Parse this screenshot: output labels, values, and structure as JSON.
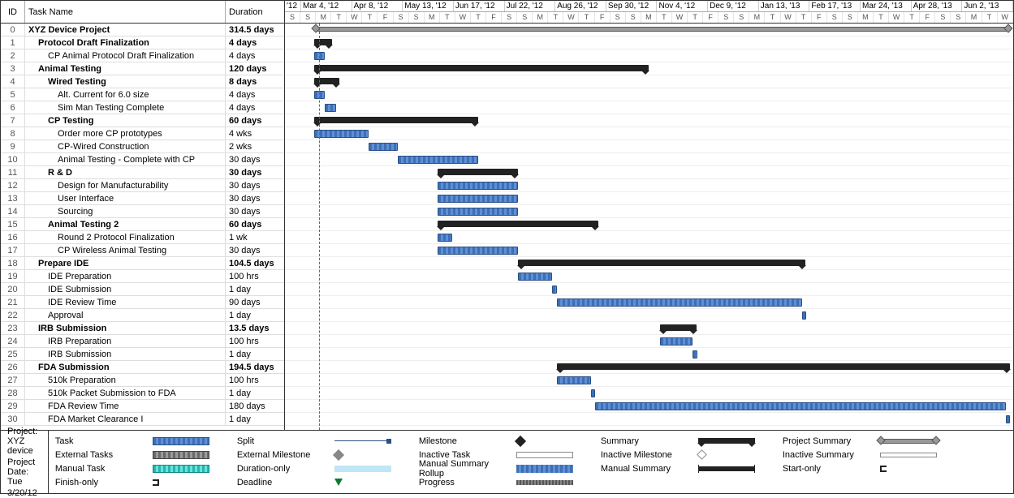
{
  "chart_data": {
    "type": "gantt",
    "project_start": "2012-03-01",
    "project_end": "2013-06-05",
    "status_date": "2012-03-20",
    "timeline_months": [
      "'12",
      "Mar 4, '12",
      "Apr 8, '12",
      "May 13, '12",
      "Jun 17, '12",
      "Jul 22, '12",
      "Aug 26, '12",
      "Sep 30, '12",
      "Nov 4, '12",
      "Dec 9, '12",
      "Jan 13, '13",
      "Feb 17, '13",
      "Mar 24, '13",
      "Apr 28, '13",
      "Jun 2, '13"
    ],
    "timeline_days": [
      "S",
      "S",
      "M",
      "T",
      "W",
      "T",
      "F",
      "S",
      "S",
      "M",
      "T",
      "W",
      "T",
      "F",
      "S",
      "S",
      "M",
      "T",
      "W",
      "T",
      "F",
      "S",
      "S",
      "M",
      "T",
      "W",
      "T",
      "F",
      "S",
      "S",
      "M",
      "T",
      "W",
      "T",
      "F",
      "S",
      "S",
      "M",
      "T",
      "W",
      "T",
      "F",
      "S",
      "S",
      "M",
      "T",
      "W"
    ],
    "tasks": [
      {
        "id": 0,
        "name": "XYZ Device Project",
        "duration": "314.5 days",
        "indent": 0,
        "bold": true,
        "type": "project",
        "bar_start": 0.04,
        "bar_end": 0.995
      },
      {
        "id": 1,
        "name": "Protocol Draft Finalization",
        "duration": "4 days",
        "indent": 1,
        "bold": true,
        "type": "summary",
        "bar_start": 0.04,
        "bar_end": 0.065
      },
      {
        "id": 2,
        "name": "CP Animal Protocol Draft Finalization",
        "duration": "4 days",
        "indent": 2,
        "bold": false,
        "type": "task",
        "bar_start": 0.04,
        "bar_end": 0.055
      },
      {
        "id": 3,
        "name": "Animal Testing",
        "duration": "120 days",
        "indent": 1,
        "bold": true,
        "type": "summary",
        "bar_start": 0.04,
        "bar_end": 0.5
      },
      {
        "id": 4,
        "name": "Wired Testing",
        "duration": "8 days",
        "indent": 2,
        "bold": true,
        "type": "summary",
        "bar_start": 0.04,
        "bar_end": 0.075
      },
      {
        "id": 5,
        "name": "Alt. Current for 6.0 size",
        "duration": "4 days",
        "indent": 3,
        "bold": false,
        "type": "task",
        "bar_start": 0.04,
        "bar_end": 0.055
      },
      {
        "id": 6,
        "name": "Sim Man Testing Complete",
        "duration": "4 days",
        "indent": 3,
        "bold": false,
        "type": "task",
        "bar_start": 0.055,
        "bar_end": 0.07
      },
      {
        "id": 7,
        "name": "CP Testing",
        "duration": "60 days",
        "indent": 2,
        "bold": true,
        "type": "summary",
        "bar_start": 0.04,
        "bar_end": 0.265
      },
      {
        "id": 8,
        "name": "Order more CP prototypes",
        "duration": "4 wks",
        "indent": 3,
        "bold": false,
        "type": "task",
        "bar_start": 0.04,
        "bar_end": 0.115
      },
      {
        "id": 9,
        "name": "CP-Wired  Construction",
        "duration": "2 wks",
        "indent": 3,
        "bold": false,
        "type": "task",
        "bar_start": 0.115,
        "bar_end": 0.155
      },
      {
        "id": 10,
        "name": "Animal Testing -  Complete with CP",
        "duration": "30 days",
        "indent": 3,
        "bold": false,
        "type": "task",
        "bar_start": 0.155,
        "bar_end": 0.265
      },
      {
        "id": 11,
        "name": "R & D",
        "duration": "30 days",
        "indent": 2,
        "bold": true,
        "type": "summary",
        "bar_start": 0.21,
        "bar_end": 0.32
      },
      {
        "id": 12,
        "name": "Design for Manufacturability",
        "duration": "30 days",
        "indent": 3,
        "bold": false,
        "type": "task",
        "bar_start": 0.21,
        "bar_end": 0.32
      },
      {
        "id": 13,
        "name": "User Interface",
        "duration": "30 days",
        "indent": 3,
        "bold": false,
        "type": "task",
        "bar_start": 0.21,
        "bar_end": 0.32
      },
      {
        "id": 14,
        "name": "Sourcing",
        "duration": "30 days",
        "indent": 3,
        "bold": false,
        "type": "task",
        "bar_start": 0.21,
        "bar_end": 0.32
      },
      {
        "id": 15,
        "name": "Animal Testing 2",
        "duration": "60 days",
        "indent": 2,
        "bold": true,
        "type": "summary",
        "bar_start": 0.21,
        "bar_end": 0.43
      },
      {
        "id": 16,
        "name": "Round 2 Protocol  Finalization",
        "duration": "1 wk",
        "indent": 3,
        "bold": false,
        "type": "task",
        "bar_start": 0.21,
        "bar_end": 0.23
      },
      {
        "id": 17,
        "name": "CP Wireless Animal Testing",
        "duration": "30 days",
        "indent": 3,
        "bold": false,
        "type": "task",
        "bar_start": 0.21,
        "bar_end": 0.32
      },
      {
        "id": 18,
        "name": "Prepare IDE",
        "duration": "104.5 days",
        "indent": 1,
        "bold": true,
        "type": "summary",
        "bar_start": 0.32,
        "bar_end": 0.715
      },
      {
        "id": 19,
        "name": "IDE Preparation",
        "duration": "100 hrs",
        "indent": 2,
        "bold": false,
        "type": "task",
        "bar_start": 0.32,
        "bar_end": 0.367
      },
      {
        "id": 20,
        "name": "IDE Submission",
        "duration": "1 day",
        "indent": 2,
        "bold": false,
        "type": "task",
        "bar_start": 0.367,
        "bar_end": 0.373
      },
      {
        "id": 21,
        "name": "IDE Review Time",
        "duration": "90 days",
        "indent": 2,
        "bold": false,
        "type": "task",
        "bar_start": 0.373,
        "bar_end": 0.71
      },
      {
        "id": 22,
        "name": "Approval",
        "duration": "1 day",
        "indent": 2,
        "bold": false,
        "type": "task",
        "bar_start": 0.71,
        "bar_end": 0.716
      },
      {
        "id": 23,
        "name": "IRB Submission",
        "duration": "13.5 days",
        "indent": 1,
        "bold": true,
        "type": "summary",
        "bar_start": 0.515,
        "bar_end": 0.565
      },
      {
        "id": 24,
        "name": "IRB Preparation",
        "duration": "100 hrs",
        "indent": 2,
        "bold": false,
        "type": "task",
        "bar_start": 0.515,
        "bar_end": 0.56
      },
      {
        "id": 25,
        "name": "IRB Submission",
        "duration": "1 day",
        "indent": 2,
        "bold": false,
        "type": "task",
        "bar_start": 0.56,
        "bar_end": 0.566
      },
      {
        "id": 26,
        "name": "FDA Submission",
        "duration": "194.5 days",
        "indent": 1,
        "bold": true,
        "type": "summary",
        "bar_start": 0.373,
        "bar_end": 0.995
      },
      {
        "id": 27,
        "name": "510k Preparation",
        "duration": "100 hrs",
        "indent": 2,
        "bold": false,
        "type": "task",
        "bar_start": 0.373,
        "bar_end": 0.42
      },
      {
        "id": 28,
        "name": "510k Packet Submission to FDA",
        "duration": "1 day",
        "indent": 2,
        "bold": false,
        "type": "task",
        "bar_start": 0.42,
        "bar_end": 0.426
      },
      {
        "id": 29,
        "name": "FDA Review Time",
        "duration": "180 days",
        "indent": 2,
        "bold": false,
        "type": "task",
        "bar_start": 0.426,
        "bar_end": 0.99
      },
      {
        "id": 30,
        "name": "FDA Market Clearance I",
        "duration": "1 day",
        "indent": 2,
        "bold": false,
        "type": "task",
        "bar_start": 0.99,
        "bar_end": 0.996
      }
    ]
  },
  "columns": {
    "id": "ID",
    "name": "Task Name",
    "dur": "Duration"
  },
  "footer": {
    "proj_label": "Project: XYZ device",
    "date_label1": "Project Date: Tue",
    "date_label2": "3/20/12"
  },
  "legend": [
    {
      "label": "Task",
      "sw": "sw-task"
    },
    {
      "label": "Split",
      "sw": "sw-split"
    },
    {
      "label": "Milestone",
      "sw": "sw-mile"
    },
    {
      "label": "Summary",
      "sw": "sw-sum"
    },
    {
      "label": "Project Summary",
      "sw": "sw-projSum"
    },
    {
      "label": "External Tasks",
      "sw": "sw-ext"
    },
    {
      "label": "External Milestone",
      "sw": "sw-extMile"
    },
    {
      "label": "Inactive Task",
      "sw": "sw-inactTask"
    },
    {
      "label": "Inactive Milestone",
      "sw": "sw-inactMile"
    },
    {
      "label": "Inactive Summary",
      "sw": "sw-inactSum"
    },
    {
      "label": "Manual Task",
      "sw": "sw-manTask"
    },
    {
      "label": "Duration-only",
      "sw": "sw-durOnly"
    },
    {
      "label": "Manual Summary Rollup",
      "sw": "sw-manRoll"
    },
    {
      "label": "Manual Summary",
      "sw": "sw-manSum"
    },
    {
      "label": "Start-only",
      "sw": "sw-startOnly"
    },
    {
      "label": "Finish-only",
      "sw": "sw-finishOnly"
    },
    {
      "label": "Deadline",
      "sw": "sw-deadline"
    },
    {
      "label": "Progress",
      "sw": "sw-progress"
    }
  ]
}
